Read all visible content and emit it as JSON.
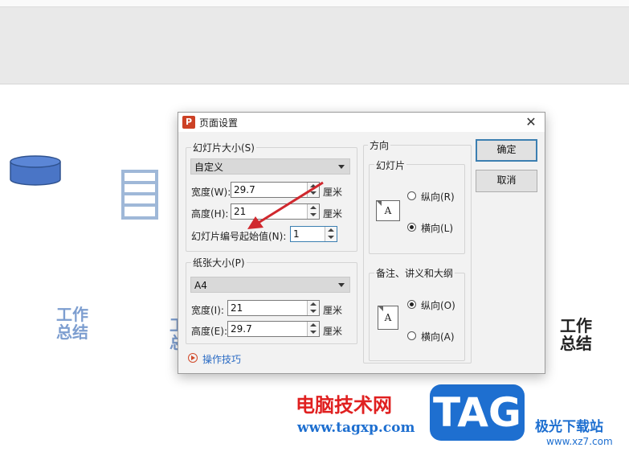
{
  "background": {
    "slide_text_left": [
      "工作",
      "总结"
    ],
    "slide_text_mid": "工",
    "slide_text_mid2": "总",
    "slide_text_right": [
      "工作",
      "总结"
    ]
  },
  "watermark": {
    "cn_text": "电脑技术网",
    "url": "www.tagxp.com",
    "tag": "TAG",
    "site2": "极光下载站",
    "site2_url": "www.xz7.com"
  },
  "dialog": {
    "app_icon": "P",
    "title": "页面设置",
    "slide_size_group": "幻灯片大小(S)",
    "slide_size_value": "自定义",
    "width_label": "宽度(W):",
    "width_value": "29.7",
    "height_label": "高度(H):",
    "height_value": "21",
    "unit": "厘米",
    "start_num_label": "幻灯片编号起始值(N):",
    "start_num_value": "1",
    "paper_group": "纸张大小(P)",
    "paper_value": "A4",
    "paper_width_label": "宽度(I):",
    "paper_width_value": "21",
    "paper_height_label": "高度(E):",
    "paper_height_value": "29.7",
    "tips_link": "操作技巧",
    "orientation_title": "方向",
    "slides_group": "幻灯片",
    "slides_portrait": "纵向(R)",
    "slides_landscape": "横向(L)",
    "notes_group": "备注、讲义和大纲",
    "notes_portrait": "纵向(O)",
    "notes_landscape": "横向(A)",
    "page_icon_letter": "A",
    "ok": "确定",
    "cancel": "取消"
  },
  "colors": {
    "accent": "#3c7fb1",
    "arrow": "#d0282e",
    "watermark_red": "#e02020",
    "watermark_blue": "#1e6fd0"
  }
}
